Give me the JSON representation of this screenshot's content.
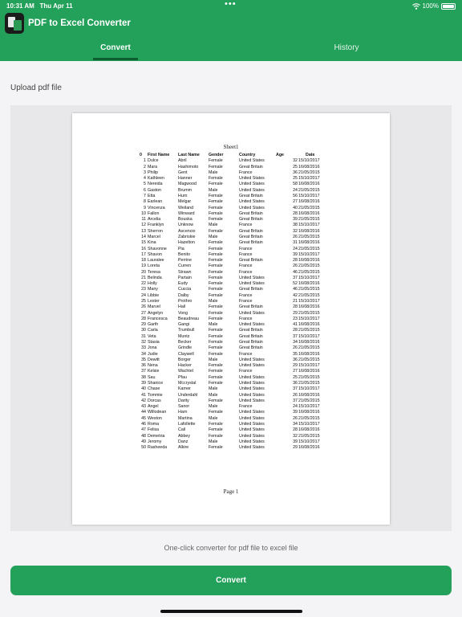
{
  "status_bar": {
    "time": "10:31 AM",
    "date": "Thu Apr 11",
    "battery": "100%",
    "battery_level": 1.0
  },
  "header": {
    "app_title": "PDF to Excel Converter"
  },
  "tabs": [
    {
      "label": "Convert",
      "selected": true
    },
    {
      "label": "History",
      "selected": false
    }
  ],
  "upload": {
    "label": "Upload pdf file"
  },
  "preview": {
    "sheet_title": "Sheet1",
    "page_number": "Page 1",
    "columns": [
      "0",
      "First Name",
      "Last Name",
      "Gender",
      "Country",
      "Age",
      "Date"
    ],
    "rows": [
      [
        "1",
        "Dulce",
        "Abril",
        "Female",
        "United States",
        "32",
        "15/10/2017"
      ],
      [
        "2",
        "Mara",
        "Hashimoto",
        "Female",
        "Great Britain",
        "25",
        "16/08/2016"
      ],
      [
        "3",
        "Philip",
        "Gent",
        "Male",
        "France",
        "36",
        "21/05/2015"
      ],
      [
        "4",
        "Kathleen",
        "Hanner",
        "Female",
        "United States",
        "25",
        "15/10/2017"
      ],
      [
        "5",
        "Nereida",
        "Magwood",
        "Female",
        "United States",
        "58",
        "16/08/2016"
      ],
      [
        "6",
        "Gaston",
        "Brumm",
        "Male",
        "United States",
        "24",
        "21/05/2015"
      ],
      [
        "7",
        "Etta",
        "Hurn",
        "Female",
        "Great Britain",
        "56",
        "15/10/2017"
      ],
      [
        "8",
        "Earlean",
        "Melgar",
        "Female",
        "United States",
        "27",
        "16/08/2016"
      ],
      [
        "9",
        "Vincenza",
        "Weiland",
        "Female",
        "United States",
        "40",
        "21/05/2015"
      ],
      [
        "10",
        "Fallon",
        "Winward",
        "Female",
        "Great Britain",
        "28",
        "16/08/2016"
      ],
      [
        "11",
        "Arcelia",
        "Bouska",
        "Female",
        "Great Britain",
        "39",
        "21/05/2015"
      ],
      [
        "12",
        "Franklyn",
        "Unknow",
        "Male",
        "France",
        "38",
        "15/10/2017"
      ],
      [
        "13",
        "Sherron",
        "Ascencio",
        "Female",
        "Great Britain",
        "32",
        "16/08/2016"
      ],
      [
        "14",
        "Marcel",
        "Zabriskie",
        "Male",
        "Great Britain",
        "26",
        "21/05/2015"
      ],
      [
        "15",
        "Kina",
        "Hazelton",
        "Female",
        "Great Britain",
        "31",
        "16/08/2016"
      ],
      [
        "16",
        "Shavonne",
        "Pia",
        "Female",
        "France",
        "24",
        "21/05/2015"
      ],
      [
        "17",
        "Shavon",
        "Benito",
        "Female",
        "France",
        "39",
        "15/10/2017"
      ],
      [
        "18",
        "Lauralee",
        "Perrine",
        "Female",
        "Great Britain",
        "28",
        "16/08/2016"
      ],
      [
        "19",
        "Loreta",
        "Curren",
        "Female",
        "France",
        "26",
        "21/05/2015"
      ],
      [
        "20",
        "Teresa",
        "Strawn",
        "Female",
        "France",
        "46",
        "21/05/2015"
      ],
      [
        "21",
        "Belinda",
        "Partain",
        "Female",
        "United States",
        "37",
        "15/10/2017"
      ],
      [
        "22",
        "Holly",
        "Eudy",
        "Female",
        "United States",
        "52",
        "16/08/2016"
      ],
      [
        "23",
        "Many",
        "Cuccia",
        "Female",
        "Great Britain",
        "46",
        "21/05/2015"
      ],
      [
        "24",
        "Libbie",
        "Dalby",
        "Female",
        "France",
        "42",
        "21/05/2015"
      ],
      [
        "25",
        "Lester",
        "Prothro",
        "Male",
        "France",
        "21",
        "15/10/2017"
      ],
      [
        "26",
        "Marvel",
        "Hail",
        "Female",
        "Great Britain",
        "28",
        "16/08/2016"
      ],
      [
        "27",
        "Angelyn",
        "Vong",
        "Female",
        "United States",
        "29",
        "21/05/2015"
      ],
      [
        "28",
        "Francesca",
        "Beaudreau",
        "Female",
        "France",
        "23",
        "15/10/2017"
      ],
      [
        "29",
        "Garth",
        "Gangi",
        "Male",
        "United States",
        "41",
        "16/08/2016"
      ],
      [
        "30",
        "Carla",
        "Trumbull",
        "Female",
        "Great Britain",
        "28",
        "21/05/2015"
      ],
      [
        "31",
        "Veta",
        "Muntz",
        "Female",
        "Great Britain",
        "37",
        "15/10/2017"
      ],
      [
        "32",
        "Stasia",
        "Becker",
        "Female",
        "Great Britain",
        "34",
        "16/08/2016"
      ],
      [
        "33",
        "Jona",
        "Grindle",
        "Female",
        "Great Britain",
        "26",
        "21/05/2015"
      ],
      [
        "34",
        "Judie",
        "Claywell",
        "Female",
        "France",
        "35",
        "16/08/2016"
      ],
      [
        "35",
        "Dewitt",
        "Borger",
        "Male",
        "United States",
        "36",
        "21/05/2015"
      ],
      [
        "36",
        "Nena",
        "Hacker",
        "Female",
        "United States",
        "29",
        "15/10/2017"
      ],
      [
        "37",
        "Kelsie",
        "Wachtel",
        "Female",
        "France",
        "27",
        "16/08/2016"
      ],
      [
        "38",
        "Sau",
        "Pfau",
        "Female",
        "United States",
        "25",
        "21/05/2015"
      ],
      [
        "39",
        "Shanice",
        "Mccrystal",
        "Female",
        "United States",
        "36",
        "21/05/2015"
      ],
      [
        "40",
        "Chase",
        "Karner",
        "Male",
        "United States",
        "37",
        "15/10/2017"
      ],
      [
        "41",
        "Tommie",
        "Underdahl",
        "Male",
        "United States",
        "26",
        "16/08/2016"
      ],
      [
        "42",
        "Dorcas",
        "Darity",
        "Female",
        "United States",
        "37",
        "21/05/2015"
      ],
      [
        "43",
        "Angel",
        "Sanor",
        "Male",
        "France",
        "24",
        "15/10/2017"
      ],
      [
        "44",
        "Willodean",
        "Harn",
        "Female",
        "United States",
        "39",
        "16/08/2016"
      ],
      [
        "45",
        "Weston",
        "Martina",
        "Male",
        "United States",
        "26",
        "21/05/2015"
      ],
      [
        "46",
        "Roma",
        "Lafollette",
        "Female",
        "United States",
        "34",
        "15/10/2017"
      ],
      [
        "47",
        "Felisa",
        "Cail",
        "Female",
        "United States",
        "28",
        "16/08/2016"
      ],
      [
        "48",
        "Demetria",
        "Abbey",
        "Female",
        "United States",
        "32",
        "21/05/2015"
      ],
      [
        "49",
        "Jeromy",
        "Danz",
        "Male",
        "United States",
        "39",
        "15/10/2017"
      ],
      [
        "50",
        "Rasheeda",
        "Alkire",
        "Female",
        "United States",
        "29",
        "16/08/2016"
      ]
    ]
  },
  "tagline": "One-click converter for pdf file to excel file",
  "convert_button": {
    "label": "Convert"
  },
  "colors": {
    "brand_green": "#23a05a",
    "tab_indicator": "#0f5e32",
    "background": "#f4f4f6"
  }
}
